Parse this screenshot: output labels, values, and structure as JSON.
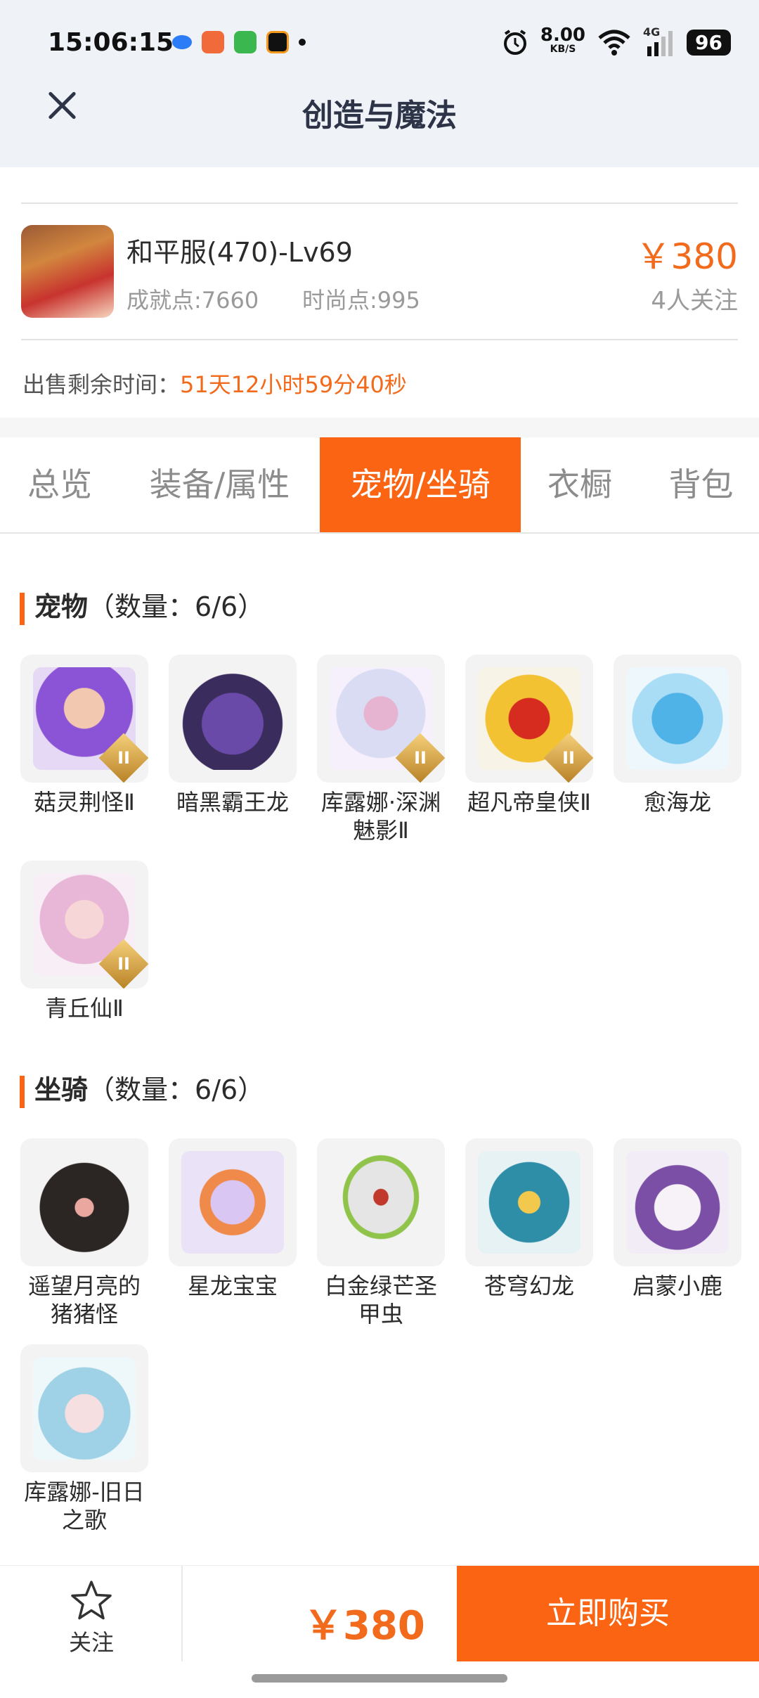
{
  "status_bar": {
    "time": "15:06:15",
    "net_speed_value": "8.00",
    "net_speed_unit": "KB/S",
    "network_type": "4G",
    "battery": "96"
  },
  "header": {
    "title": "创造与魔法"
  },
  "account": {
    "name": "和平服(470)-Lv69",
    "achievement": "成就点:7660",
    "fashion": "时尚点:995",
    "price": "￥380",
    "followers": "4人关注",
    "remain_label": "出售剩余时间：",
    "remain_value": "51天12小时59分40秒"
  },
  "tabs": [
    "总览",
    "装备/属性",
    "宠物/坐骑",
    "衣橱",
    "背包"
  ],
  "pets": {
    "title": "宠物",
    "count": "（数量：6/6）",
    "items": [
      "菇灵荆怪Ⅱ",
      "暗黑霸王龙",
      "库露娜·深渊魅影Ⅱ",
      "超凡帝皇侠Ⅱ",
      "愈海龙",
      "青丘仙Ⅱ"
    ]
  },
  "mounts": {
    "title": "坐骑",
    "count": "（数量：6/6）",
    "items": [
      "遥望月亮的猪猪怪",
      "星龙宝宝",
      "白金绿芒圣甲虫",
      "苍穹幻龙",
      "启蒙小鹿",
      "库露娜-旧日之歌"
    ]
  },
  "bottom": {
    "follow_label": "关注",
    "price": "￥380",
    "buy_label": "立即购买"
  },
  "colors": {
    "accent": "#fb6413",
    "price": "#f26a1b"
  }
}
